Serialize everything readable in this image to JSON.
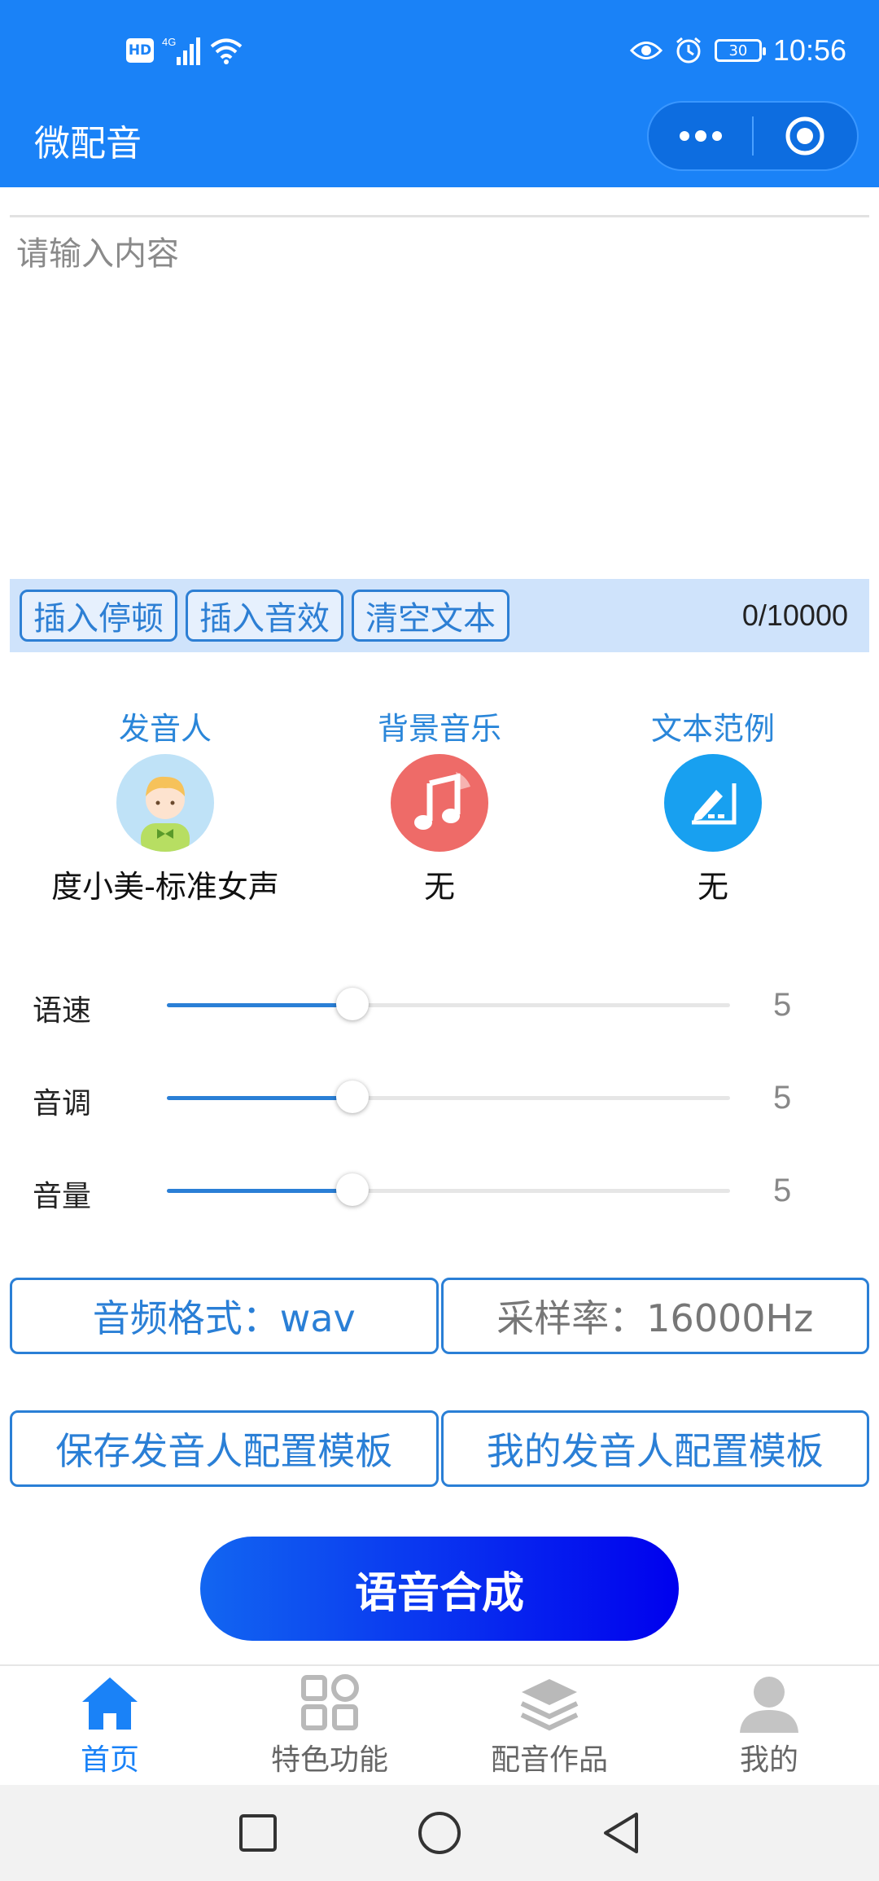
{
  "status_bar": {
    "time": "10:56",
    "battery": "30",
    "hd": "HD",
    "network": "4G"
  },
  "header": {
    "title": "微配音"
  },
  "editor": {
    "placeholder": "请输入内容"
  },
  "toolbar": {
    "buttons": [
      "插入停顿",
      "插入音效",
      "清空文本"
    ],
    "counter": "0/10000"
  },
  "options": [
    {
      "title": "发音人",
      "value": "度小美-标准女声",
      "icon": "avatar-icon"
    },
    {
      "title": "背景音乐",
      "value": "无",
      "icon": "music-note-icon"
    },
    {
      "title": "文本范例",
      "value": "无",
      "icon": "edit-icon"
    }
  ],
  "sliders": [
    {
      "label": "语速",
      "value": "5",
      "fraction": 0.33
    },
    {
      "label": "音调",
      "value": "5",
      "fraction": 0.33
    },
    {
      "label": "音量",
      "value": "5",
      "fraction": 0.33
    }
  ],
  "format": {
    "audio_format": "音频格式：wav",
    "sample_rate": "采样率：16000Hz"
  },
  "templates": {
    "save": "保存发音人配置模板",
    "mine": "我的发音人配置模板"
  },
  "synthesize_label": "语音合成",
  "tabs": [
    {
      "label": "首页",
      "icon": "home-icon",
      "active": true
    },
    {
      "label": "特色功能",
      "icon": "grid-icon",
      "active": false
    },
    {
      "label": "配音作品",
      "icon": "layers-icon",
      "active": false
    },
    {
      "label": "我的",
      "icon": "person-icon",
      "active": false
    }
  ],
  "colors": {
    "primary": "#1a82f7",
    "accent_blue": "#2a7fd6",
    "music_red": "#ee6b68",
    "toolbar_bg": "#cfe3fb"
  }
}
